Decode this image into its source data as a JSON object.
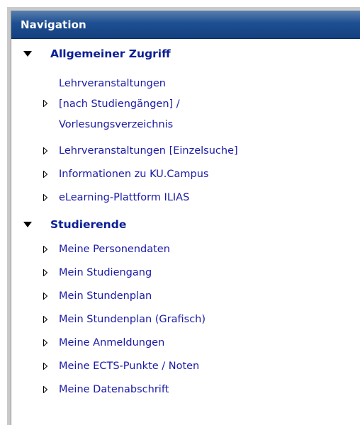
{
  "nav": {
    "title": "Navigation",
    "sections": [
      {
        "label": "Allgemeiner Zugriff",
        "items": [
          {
            "lines": [
              "Lehrveranstaltungen",
              "[nach Studiengängen] /",
              "Vorlesungsverzeichnis"
            ]
          },
          {
            "label": "Lehrveranstaltungen [Einzelsuche]"
          },
          {
            "label": "Informationen zu KU.Campus"
          },
          {
            "label": "eLearning-Plattform ILIAS"
          }
        ]
      },
      {
        "label": "Studierende",
        "items": [
          {
            "label": "Meine Personendaten"
          },
          {
            "label": "Mein Studiengang"
          },
          {
            "label": "Mein Stundenplan"
          },
          {
            "label": "Mein Stundenplan (Grafisch)"
          },
          {
            "label": "Meine Anmeldungen"
          },
          {
            "label": "Meine ECTS-Punkte / Noten"
          },
          {
            "label": "Meine Datenabschrift"
          }
        ]
      }
    ]
  },
  "colors": {
    "header_bg": "#1d4f92",
    "section_text": "#0a1e96",
    "link_text": "#1a1aa6",
    "frame": "#c9c9c9"
  }
}
